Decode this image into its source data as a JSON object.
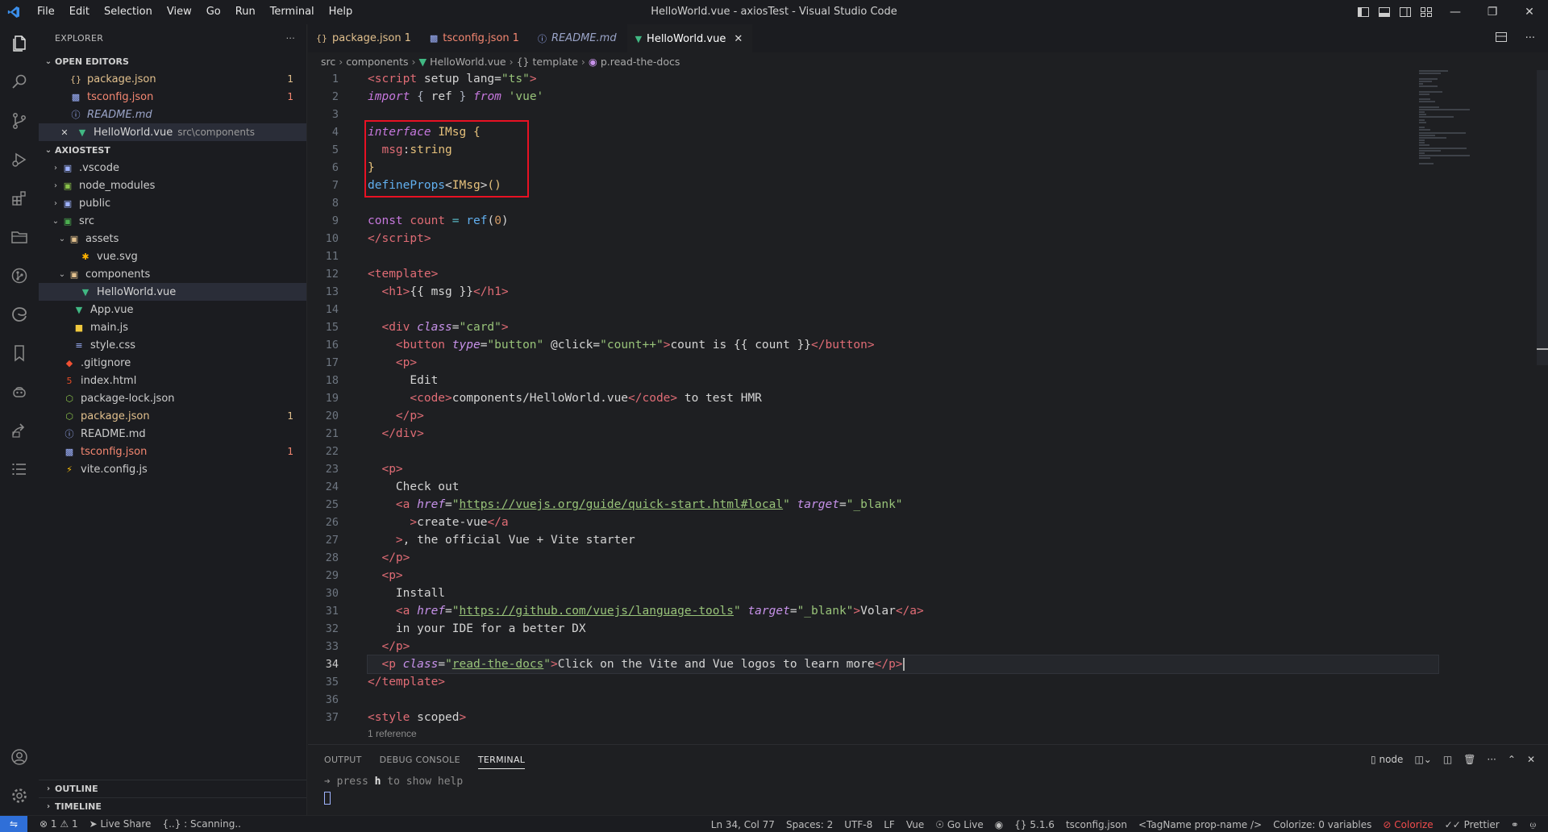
{
  "window": {
    "title": "HelloWorld.vue - axiosTest - Visual Studio Code",
    "menu": [
      "File",
      "Edit",
      "Selection",
      "View",
      "Go",
      "Run",
      "Terminal",
      "Help"
    ]
  },
  "sidebar": {
    "header": "EXPLORER",
    "open_editors_label": "OPEN EDITORS",
    "open_editors": [
      {
        "name": "package.json",
        "badge": "1"
      },
      {
        "name": "tsconfig.json",
        "badge": "1"
      },
      {
        "name": "README.md",
        "badge": ""
      },
      {
        "name": "HelloWorld.vue",
        "path": "src\\components",
        "badge": ""
      }
    ],
    "project_label": "AXIOSTEST",
    "tree": [
      {
        "name": ".vscode"
      },
      {
        "name": "node_modules"
      },
      {
        "name": "public"
      },
      {
        "name": "src"
      },
      {
        "name": "assets"
      },
      {
        "name": "vue.svg"
      },
      {
        "name": "components"
      },
      {
        "name": "HelloWorld.vue"
      },
      {
        "name": "App.vue"
      },
      {
        "name": "main.js"
      },
      {
        "name": "style.css"
      },
      {
        "name": ".gitignore"
      },
      {
        "name": "index.html"
      },
      {
        "name": "package-lock.json"
      },
      {
        "name": "package.json",
        "badge": "1"
      },
      {
        "name": "README.md"
      },
      {
        "name": "tsconfig.json",
        "badge": "1"
      },
      {
        "name": "vite.config.js"
      }
    ],
    "outline_label": "OUTLINE",
    "timeline_label": "TIMELINE"
  },
  "tabs": [
    {
      "label": "package.json",
      "badge": "1"
    },
    {
      "label": "tsconfig.json",
      "badge": "1"
    },
    {
      "label": "README.md",
      "badge": ""
    },
    {
      "label": "HelloWorld.vue",
      "badge": ""
    }
  ],
  "breadcrumb": [
    "src",
    "components",
    "HelloWorld.vue",
    "{} template",
    "p.read-the-docs"
  ],
  "editor": {
    "line_numbers": [
      "1",
      "2",
      "3",
      "4",
      "5",
      "6",
      "7",
      "8",
      "9",
      "10",
      "11",
      "12",
      "13",
      "14",
      "15",
      "16",
      "17",
      "18",
      "19",
      "20",
      "21",
      "22",
      "23",
      "24",
      "25",
      "26",
      "27",
      "28",
      "29",
      "30",
      "31",
      "32",
      "33",
      "34",
      "35",
      "36",
      "37"
    ],
    "reference_hint": "1 reference",
    "cursor_line": "34"
  },
  "panel": {
    "tabs": [
      "OUTPUT",
      "DEBUG CONSOLE",
      "TERMINAL"
    ],
    "terminal_name": "node",
    "terminal_prompt_a": "press",
    "terminal_prompt_key": "h",
    "terminal_prompt_b": "to show help"
  },
  "status": {
    "problems": "1",
    "warnings": "1",
    "live_share": "Live Share",
    "scanning": "{..} : Scanning..",
    "position": "Ln 34, Col 77",
    "spaces": "Spaces: 2",
    "encoding": "UTF-8",
    "eol": "LF",
    "language": "Vue",
    "go_live": "Go Live",
    "version": "5.1.6",
    "tsconfig": "tsconfig.json",
    "tagname": "<TagName prop-name />",
    "colorize_vars": "Colorize: 0 variables",
    "colorize": "Colorize",
    "prettier": "Prettier"
  },
  "colors": {
    "accent": "#2f6fd8",
    "highlight_box": "#e81123",
    "modified_file": "#e2c08d",
    "error_file": "#f48771"
  }
}
